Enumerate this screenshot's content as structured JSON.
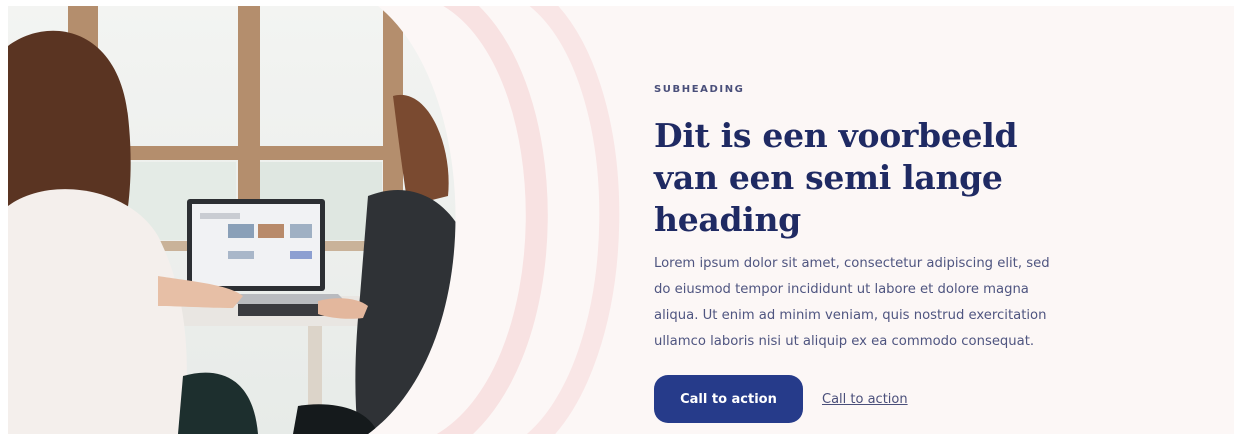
{
  "hero": {
    "subheading": "SUBHEADING",
    "heading_line1": "Dit is een voorbeeld",
    "heading_line2": "van een semi lange heading",
    "body_line1": "Lorem ipsum dolor sit amet, consectetur adipiscing elit, sed",
    "body_line2": "do eiusmod tempor incididunt ut labore et dolore magna",
    "body_line3": "aliqua. Ut enim ad minim veniam, quis nostrud exercitation",
    "body_line4": "ullamco laboris nisi ut aliquip ex ea commodo consequat.",
    "primary_cta": "Call to action",
    "secondary_cta": "Call to action"
  },
  "colors": {
    "background": "#fcf7f6",
    "accent": "#263b8a",
    "heading": "#1f2a63",
    "arc": "#f9e3e3"
  },
  "image": {
    "icon": "photo-two-women-laptop"
  }
}
